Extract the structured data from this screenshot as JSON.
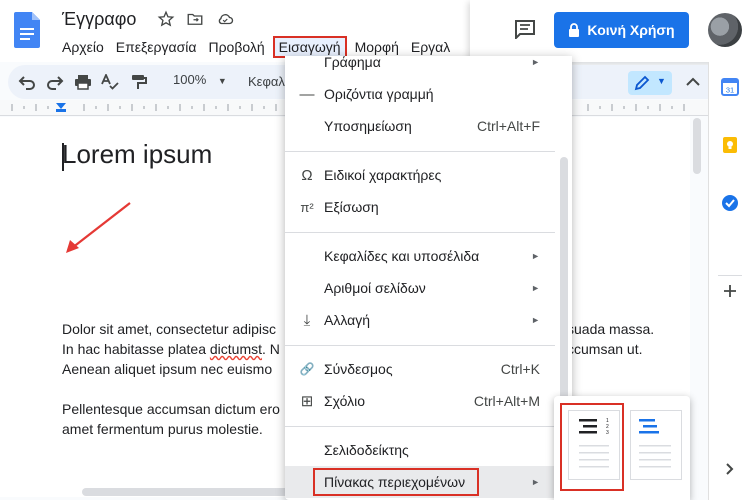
{
  "header": {
    "doc_title": "Έγγραφο",
    "menus": [
      "Αρχείο",
      "Επεξεργασία",
      "Προβολή",
      "Εισαγωγή",
      "Μορφή",
      "Εργαλ"
    ],
    "active_menu_index": 3,
    "share_label": "Κοινή Χρήση"
  },
  "toolbar": {
    "zoom": "100%",
    "style": "Κεφαλ"
  },
  "document": {
    "heading": "Lorem ipsum",
    "para1_line1_a": "Dolor sit amet, consectetur adipisc",
    "para1_line1_b": "suada massa.",
    "para1_line2_a": "In hac habitasse platea ",
    "para1_line2_err": "dictumst",
    "para1_line2_b": ". N",
    "para1_line2_c": "ccumsan ut.",
    "para1_line3_a": "Aenean aliquet ipsum nec euismo",
    "para2_line1_a": "Pellentesque accumsan dictum ero",
    "para2_line2": "amet fermentum purus molestie."
  },
  "insert_menu": {
    "items": [
      {
        "label": "Γράφημα",
        "icon": "",
        "shortcut": "",
        "submenu": true
      },
      {
        "label": "Οριζόντια γραμμή",
        "icon": "—",
        "shortcut": "",
        "submenu": false
      },
      {
        "label": "Υποσημείωση",
        "icon": "",
        "shortcut": "Ctrl+Alt+F",
        "submenu": false
      },
      {
        "label": "Ειδικοί χαρακτήρες",
        "icon": "Ω",
        "shortcut": "",
        "submenu": false
      },
      {
        "label": "Εξίσωση",
        "icon": "π²",
        "shortcut": "",
        "submenu": false
      },
      {
        "label": "Κεφαλίδες και υποσέλιδα",
        "icon": "",
        "shortcut": "",
        "submenu": true
      },
      {
        "label": "Αριθμοί σελίδων",
        "icon": "",
        "shortcut": "",
        "submenu": true
      },
      {
        "label": "Αλλαγή",
        "icon": "⤓",
        "shortcut": "",
        "submenu": true
      },
      {
        "label": "Σύνδεσμος",
        "icon": "🔗",
        "shortcut": "Ctrl+K",
        "submenu": false
      },
      {
        "label": "Σχόλιο",
        "icon": "⊞",
        "shortcut": "Ctrl+Alt+M",
        "submenu": false
      },
      {
        "label": "Σελιδοδείκτης",
        "icon": "",
        "shortcut": "",
        "submenu": false
      },
      {
        "label": "Πίνακας περιεχομένων",
        "icon": "",
        "shortcut": "",
        "submenu": true
      }
    ]
  },
  "toc_submenu": {
    "options": [
      "with-page-numbers",
      "with-blue-links"
    ],
    "selected": 0
  },
  "colors": {
    "accent": "#1a73e8",
    "highlight_red": "#d93025"
  }
}
